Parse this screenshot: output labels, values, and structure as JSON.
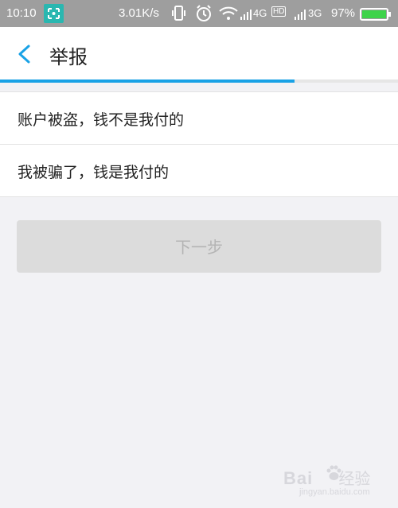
{
  "status_bar": {
    "time": "10:10",
    "net_speed": "3.01K/s",
    "network_4g": "4G",
    "hd_badge": "HD",
    "network_3g": "3G",
    "battery": "97%"
  },
  "header": {
    "title": "举报"
  },
  "progress": {
    "fraction": 0.74,
    "color": "#19a2e6"
  },
  "options": [
    {
      "label": "账户被盗，钱不是我付的"
    },
    {
      "label": "我被骗了，钱是我付的"
    }
  ],
  "next_button": {
    "label": "下一步",
    "enabled": false
  },
  "watermark": {
    "brand": "Bai",
    "brand_suffix": "经验",
    "url": "jingyan.baidu.com"
  },
  "colors": {
    "accent": "#19a2e6",
    "status_bar_bg": "#9e9e9e",
    "page_bg": "#f2f2f5"
  }
}
